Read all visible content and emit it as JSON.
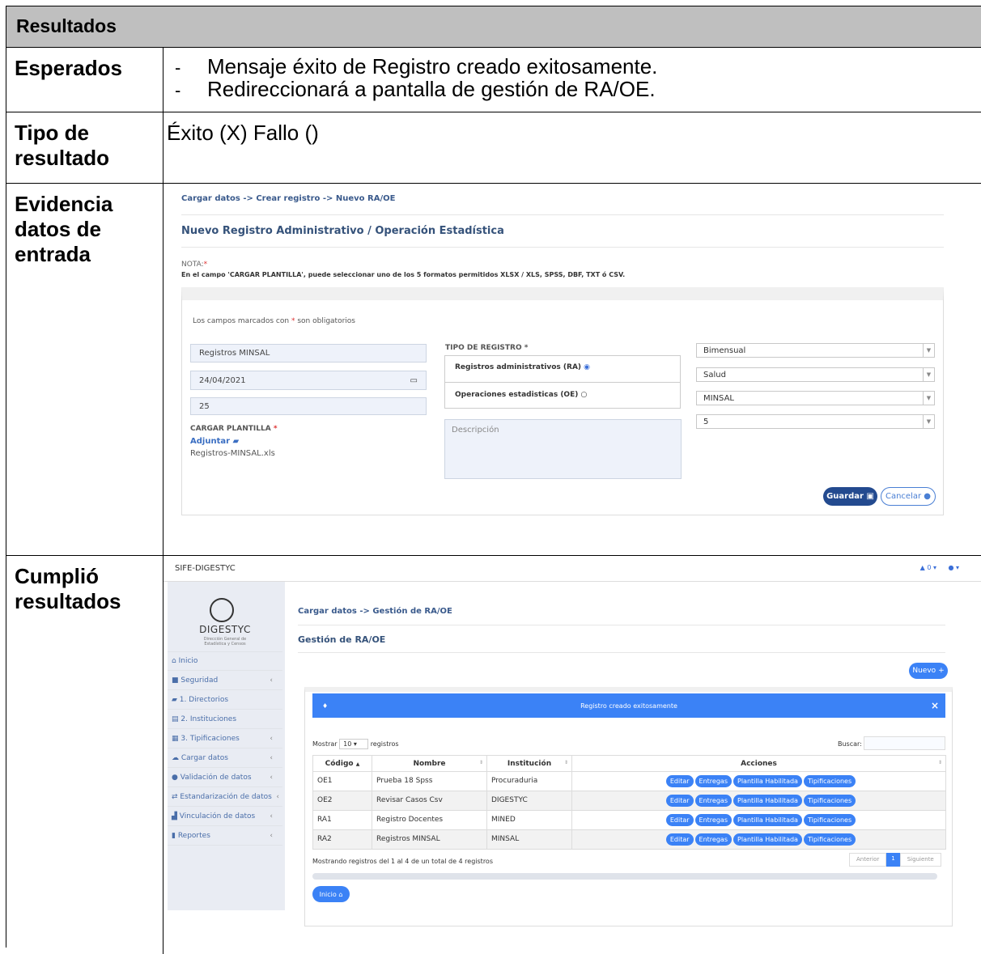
{
  "header": "Resultados",
  "rows": {
    "esperados": {
      "label": "Esperados",
      "items": [
        "Mensaje éxito de Registro creado exitosamente.",
        "Redireccionará a pantalla de gestión de RA/OE."
      ]
    },
    "tipo": {
      "label_line1": "Tipo de",
      "label_line2": "resultado",
      "value": "Éxito (X) Fallo ()"
    },
    "evidencia": {
      "label_line1": "Evidencia",
      "label_line2": "datos de",
      "label_line3": "entrada"
    },
    "cumplio": {
      "label_line1": "Cumplió",
      "label_line2": "resultados"
    }
  },
  "form": {
    "breadcrumb": "Cargar datos -> Crear registro -> Nuevo RA/OE",
    "title": "Nuevo Registro Administrativo / Operación Estadística",
    "nota_label": "NOTA:",
    "nota_text": "En el campo 'CARGAR PLANTILLA', puede seleccionar uno de los 5 formatos permitidos XLSX / XLS, SPSS, DBF, TXT ó CSV.",
    "required_prefix": "Los campos marcados con",
    "required_suffix": "son obligatorios",
    "nombre_value": "Registros MINSAL",
    "fecha_value": "24/04/2021",
    "numero_value": "25",
    "cargar_label": "CARGAR PLANTILLA",
    "adjuntar_label": "Adjuntar",
    "file_name": "Registros-MINSAL.xls",
    "tipo_registro_label": "TIPO DE REGISTRO",
    "option_ra": "Registros administrativos (RA)",
    "option_oe": "Operaciones estadisticas (OE)",
    "descripcion_placeholder": "Descripción",
    "selects": [
      "Bimensual",
      "Salud",
      "MINSAL",
      "5"
    ],
    "guardar": "Guardar",
    "cancelar": "Cancelar"
  },
  "app": {
    "brand": "SIFE-DIGESTYC",
    "notif_count": "0",
    "logo_text": "DIGESTYC",
    "logo_sub1": "Dirección General de",
    "logo_sub2": "Estadística y Censos",
    "sidebar": [
      "Inicio",
      "Seguridad",
      "1. Directorios",
      "2. Instituciones",
      "3. Tipificaciones",
      "Cargar datos",
      "Validación de datos",
      "Estandarización de datos",
      "Vinculación de datos",
      "Reportes"
    ],
    "breadcrumb": "Cargar datos -> Gestión de RA/OE",
    "title": "Gestión de RA/OE",
    "nuevo": "Nuevo",
    "alert": "Registro creado exitosamente",
    "mostrar": "Mostrar",
    "page_size": "10",
    "registros": "registros",
    "buscar": "Buscar:",
    "columns": [
      "Código",
      "Nombre",
      "Institución",
      "Acciones"
    ],
    "rows": [
      {
        "codigo": "OE1",
        "nombre": "Prueba 18 Spss",
        "institucion": "Procuraduria"
      },
      {
        "codigo": "OE2",
        "nombre": "Revisar Casos Csv",
        "institucion": "DIGESTYC"
      },
      {
        "codigo": "RA1",
        "nombre": "Registro Docentes",
        "institucion": "MINED"
      },
      {
        "codigo": "RA2",
        "nombre": "Registros MINSAL",
        "institucion": "MINSAL"
      }
    ],
    "actions": [
      "Editar",
      "Entregas",
      "Plantilla Habilitada",
      "Tipificaciones"
    ],
    "footer_info": "Mostrando registros del 1 al 4 de un total de 4 registros",
    "anterior": "Anterior",
    "page": "1",
    "siguiente": "Siguiente",
    "inicio": "Inicio"
  }
}
